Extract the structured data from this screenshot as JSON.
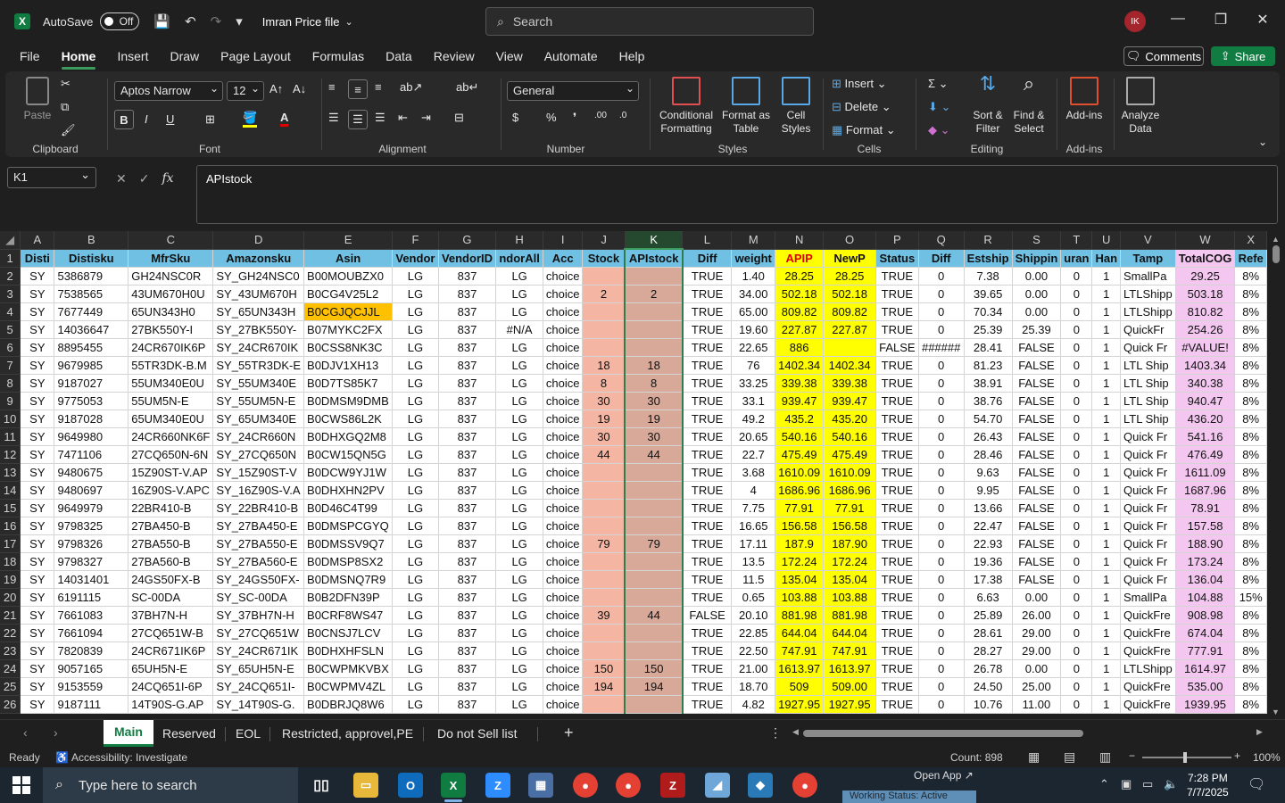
{
  "title_bar": {
    "autosave_label": "AutoSave",
    "autosave_state": "Off",
    "filename": "Imran Price file",
    "search_placeholder": "Search",
    "avatar_initials": "IK"
  },
  "menu": {
    "tabs": [
      "File",
      "Home",
      "Insert",
      "Draw",
      "Page Layout",
      "Formulas",
      "Data",
      "Review",
      "View",
      "Automate",
      "Help"
    ],
    "active": "Home",
    "comments_label": "Comments",
    "share_label": "Share"
  },
  "ribbon": {
    "paste_label": "Paste",
    "font_name": "Aptos Narrow",
    "font_size": "12",
    "number_format": "General",
    "conditional_formatting": "Conditional Formatting",
    "format_as_table": "Format as Table",
    "cell_styles": "Cell Styles",
    "insert": "Insert",
    "delete": "Delete",
    "format": "Format",
    "sort_filter": "Sort & Filter",
    "find_select": "Find & Select",
    "add_ins": "Add-ins",
    "analyze_data": "Analyze Data",
    "groups": {
      "clipboard": "Clipboard",
      "font": "Font",
      "alignment": "Alignment",
      "number": "Number",
      "styles": "Styles",
      "cells": "Cells",
      "editing": "Editing",
      "addins": "Add-ins"
    }
  },
  "formula_bar": {
    "name_box": "K1",
    "fx_label": "fx",
    "formula": "APIstock"
  },
  "grid": {
    "columns": [
      "A",
      "B",
      "C",
      "D",
      "E",
      "F",
      "G",
      "H",
      "I",
      "J",
      "K",
      "L",
      "M",
      "N",
      "O",
      "P",
      "Q",
      "R",
      "S",
      "T",
      "U",
      "V",
      "W",
      "X"
    ],
    "selected_column": "K",
    "header_row": [
      "Disti",
      "Distisku",
      "MfrSku",
      "Amazonsku",
      "Asin",
      "Vendor",
      "VendorID",
      "ndorAll",
      "Acc",
      "Stock",
      "APIstock",
      "Diff",
      "weight",
      "APIP",
      "NewP",
      "Status",
      "Diff",
      "Estship",
      "Shippin",
      "uran",
      "Han",
      "Tamp",
      "TotalCOG",
      "Refe"
    ],
    "rows": [
      [
        "SY",
        "5386879",
        "GH24NSC0R",
        "SY_GH24NSC0",
        "B00MOUBZX0",
        "LG",
        "837",
        "LG",
        "choice",
        "",
        "",
        "TRUE",
        "1.40",
        "28.25",
        "28.25",
        "TRUE",
        "0",
        "7.38",
        "0.00",
        "0",
        "1",
        "SmallPa",
        "29.25",
        "8%"
      ],
      [
        "SY",
        "7538565",
        "43UM670H0U",
        "SY_43UM670H",
        "B0CG4V25L2",
        "LG",
        "837",
        "LG",
        "choice",
        "2",
        "2",
        "TRUE",
        "34.00",
        "502.18",
        "502.18",
        "TRUE",
        "0",
        "39.65",
        "0.00",
        "0",
        "1",
        "LTLShipp",
        "503.18",
        "8%"
      ],
      [
        "SY",
        "7677449",
        "65UN343H0",
        "SY_65UN343H",
        "B0CGJQCJJL",
        "LG",
        "837",
        "LG",
        "choice",
        "",
        "",
        "TRUE",
        "65.00",
        "809.82",
        "809.82",
        "TRUE",
        "0",
        "70.34",
        "0.00",
        "0",
        "1",
        "LTLShipp",
        "810.82",
        "8%"
      ],
      [
        "SY",
        "14036647",
        "27BK550Y-I",
        "SY_27BK550Y-",
        "B07MYKC2FX",
        "LG",
        "837",
        "#N/A",
        "choice",
        "",
        "",
        "TRUE",
        "19.60",
        "227.87",
        "227.87",
        "TRUE",
        "0",
        "25.39",
        "25.39",
        "0",
        "1",
        "QuickFr",
        "254.26",
        "8%"
      ],
      [
        "SY",
        "8895455",
        "24CR670IK6P",
        "SY_24CR670IK",
        "B0CSS8NK3C",
        "LG",
        "837",
        "LG",
        "choice",
        "",
        "",
        "TRUE",
        "22.65",
        "886",
        "",
        "FALSE",
        "######",
        "28.41",
        "FALSE",
        "0",
        "1",
        "Quick Fr",
        "#VALUE!",
        "8%"
      ],
      [
        "SY",
        "9679985",
        "55TR3DK-B.M",
        "SY_55TR3DK-E",
        "B0DJV1XH13",
        "LG",
        "837",
        "LG",
        "choice",
        "18",
        "18",
        "TRUE",
        "76",
        "1402.34",
        "1402.34",
        "TRUE",
        "0",
        "81.23",
        "FALSE",
        "0",
        "1",
        "LTL Ship",
        "1403.34",
        "8%"
      ],
      [
        "SY",
        "9187027",
        "55UM340E0U",
        "SY_55UM340E",
        "B0D7TS85K7",
        "LG",
        "837",
        "LG",
        "choice",
        "8",
        "8",
        "TRUE",
        "33.25",
        "339.38",
        "339.38",
        "TRUE",
        "0",
        "38.91",
        "FALSE",
        "0",
        "1",
        "LTL Ship",
        "340.38",
        "8%"
      ],
      [
        "SY",
        "9775053",
        "55UM5N-E",
        "SY_55UM5N-E",
        "B0DMSM9DMB",
        "LG",
        "837",
        "LG",
        "choice",
        "30",
        "30",
        "TRUE",
        "33.1",
        "939.47",
        "939.47",
        "TRUE",
        "0",
        "38.76",
        "FALSE",
        "0",
        "1",
        "LTL Ship",
        "940.47",
        "8%"
      ],
      [
        "SY",
        "9187028",
        "65UM340E0U",
        "SY_65UM340E",
        "B0CWS86L2K",
        "LG",
        "837",
        "LG",
        "choice",
        "19",
        "19",
        "TRUE",
        "49.2",
        "435.2",
        "435.20",
        "TRUE",
        "0",
        "54.70",
        "FALSE",
        "0",
        "1",
        "LTL Ship",
        "436.20",
        "8%"
      ],
      [
        "SY",
        "9649980",
        "24CR660NK6F",
        "SY_24CR660N",
        "B0DHXGQ2M8",
        "LG",
        "837",
        "LG",
        "choice",
        "30",
        "30",
        "TRUE",
        "20.65",
        "540.16",
        "540.16",
        "TRUE",
        "0",
        "26.43",
        "FALSE",
        "0",
        "1",
        "Quick Fr",
        "541.16",
        "8%"
      ],
      [
        "SY",
        "7471106",
        "27CQ650N-6N",
        "SY_27CQ650N",
        "B0CW15QN5G",
        "LG",
        "837",
        "LG",
        "choice",
        "44",
        "44",
        "TRUE",
        "22.7",
        "475.49",
        "475.49",
        "TRUE",
        "0",
        "28.46",
        "FALSE",
        "0",
        "1",
        "Quick Fr",
        "476.49",
        "8%"
      ],
      [
        "SY",
        "9480675",
        "15Z90ST-V.AP",
        "SY_15Z90ST-V",
        "B0DCW9YJ1W",
        "LG",
        "837",
        "LG",
        "choice",
        "",
        "",
        "TRUE",
        "3.68",
        "1610.09",
        "1610.09",
        "TRUE",
        "0",
        "9.63",
        "FALSE",
        "0",
        "1",
        "Quick Fr",
        "1611.09",
        "8%"
      ],
      [
        "SY",
        "9480697",
        "16Z90S-V.APC",
        "SY_16Z90S-V.A",
        "B0DHXHN2PV",
        "LG",
        "837",
        "LG",
        "choice",
        "",
        "",
        "TRUE",
        "4",
        "1686.96",
        "1686.96",
        "TRUE",
        "0",
        "9.95",
        "FALSE",
        "0",
        "1",
        "Quick Fr",
        "1687.96",
        "8%"
      ],
      [
        "SY",
        "9649979",
        "22BR410-B",
        "SY_22BR410-B",
        "B0D46C4T99",
        "LG",
        "837",
        "LG",
        "choice",
        "",
        "",
        "TRUE",
        "7.75",
        "77.91",
        "77.91",
        "TRUE",
        "0",
        "13.66",
        "FALSE",
        "0",
        "1",
        "Quick Fr",
        "78.91",
        "8%"
      ],
      [
        "SY",
        "9798325",
        "27BA450-B",
        "SY_27BA450-E",
        "B0DMSPCGYQ",
        "LG",
        "837",
        "LG",
        "choice",
        "",
        "",
        "TRUE",
        "16.65",
        "156.58",
        "156.58",
        "TRUE",
        "0",
        "22.47",
        "FALSE",
        "0",
        "1",
        "Quick Fr",
        "157.58",
        "8%"
      ],
      [
        "SY",
        "9798326",
        "27BA550-B",
        "SY_27BA550-E",
        "B0DMSSV9Q7",
        "LG",
        "837",
        "LG",
        "choice",
        "79",
        "79",
        "TRUE",
        "17.11",
        "187.9",
        "187.90",
        "TRUE",
        "0",
        "22.93",
        "FALSE",
        "0",
        "1",
        "Quick Fr",
        "188.90",
        "8%"
      ],
      [
        "SY",
        "9798327",
        "27BA560-B",
        "SY_27BA560-E",
        "B0DMSP8SX2",
        "LG",
        "837",
        "LG",
        "choice",
        "",
        "",
        "TRUE",
        "13.5",
        "172.24",
        "172.24",
        "TRUE",
        "0",
        "19.36",
        "FALSE",
        "0",
        "1",
        "Quick Fr",
        "173.24",
        "8%"
      ],
      [
        "SY",
        "14031401",
        "24GS50FX-B",
        "SY_24GS50FX-",
        "B0DMSNQ7R9",
        "LG",
        "837",
        "LG",
        "choice",
        "",
        "",
        "TRUE",
        "11.5",
        "135.04",
        "135.04",
        "TRUE",
        "0",
        "17.38",
        "FALSE",
        "0",
        "1",
        "Quick Fr",
        "136.04",
        "8%"
      ],
      [
        "SY",
        "6191115",
        "SC-00DA",
        "SY_SC-00DA",
        "B0B2DFN39P",
        "LG",
        "837",
        "LG",
        "choice",
        "",
        "",
        "TRUE",
        "0.65",
        "103.88",
        "103.88",
        "TRUE",
        "0",
        "6.63",
        "0.00",
        "0",
        "1",
        "SmallPa",
        "104.88",
        "15%"
      ],
      [
        "SY",
        "7661083",
        "37BH7N-H",
        "SY_37BH7N-H",
        "B0CRF8WS47",
        "LG",
        "837",
        "LG",
        "choice",
        "39",
        "44",
        "FALSE",
        "20.10",
        "881.98",
        "881.98",
        "TRUE",
        "0",
        "25.89",
        "26.00",
        "0",
        "1",
        "QuickFre",
        "908.98",
        "8%"
      ],
      [
        "SY",
        "7661094",
        "27CQ651W-B",
        "SY_27CQ651W",
        "B0CNSJ7LCV",
        "LG",
        "837",
        "LG",
        "choice",
        "",
        "",
        "TRUE",
        "22.85",
        "644.04",
        "644.04",
        "TRUE",
        "0",
        "28.61",
        "29.00",
        "0",
        "1",
        "QuickFre",
        "674.04",
        "8%"
      ],
      [
        "SY",
        "7820839",
        "24CR671IK6P",
        "SY_24CR671IK",
        "B0DHXHFSLN",
        "LG",
        "837",
        "LG",
        "choice",
        "",
        "",
        "TRUE",
        "22.50",
        "747.91",
        "747.91",
        "TRUE",
        "0",
        "28.27",
        "29.00",
        "0",
        "1",
        "QuickFre",
        "777.91",
        "8%"
      ],
      [
        "SY",
        "9057165",
        "65UH5N-E",
        "SY_65UH5N-E",
        "B0CWPMKVBX",
        "LG",
        "837",
        "LG",
        "choice",
        "150",
        "150",
        "TRUE",
        "21.00",
        "1613.97",
        "1613.97",
        "TRUE",
        "0",
        "26.78",
        "0.00",
        "0",
        "1",
        "LTLShipp",
        "1614.97",
        "8%"
      ],
      [
        "SY",
        "9153559",
        "24CQ651I-6P",
        "SY_24CQ651I-",
        "B0CWPMV4ZL",
        "LG",
        "837",
        "LG",
        "choice",
        "194",
        "194",
        "TRUE",
        "18.70",
        "509",
        "509.00",
        "TRUE",
        "0",
        "24.50",
        "25.00",
        "0",
        "1",
        "QuickFre",
        "535.00",
        "8%"
      ],
      [
        "SY",
        "9187111",
        "14T90S-G.AP",
        "SY_14T90S-G.",
        "B0DBRJQ8W6",
        "LG",
        "837",
        "LG",
        "choice",
        "",
        "",
        "TRUE",
        "4.82",
        "1927.95",
        "1927.95",
        "TRUE",
        "0",
        "10.76",
        "11.00",
        "0",
        "1",
        "QuickFre",
        "1939.95",
        "8%"
      ]
    ]
  },
  "sheet_tabs": [
    "Main",
    "Reserved",
    "EOL",
    "Restricted, approvel,PE",
    "Do not Sell list"
  ],
  "active_sheet": "Main",
  "status_bar": {
    "ready": "Ready",
    "accessibility": "Accessibility: Investigate",
    "count": "Count: 898",
    "zoom": "100%"
  },
  "taskbar": {
    "search_placeholder": "Type here to search",
    "open_app": "Open App ↗",
    "work_status": "Working Status: Active",
    "time": "7:28 PM",
    "date": "7/7/2025"
  }
}
